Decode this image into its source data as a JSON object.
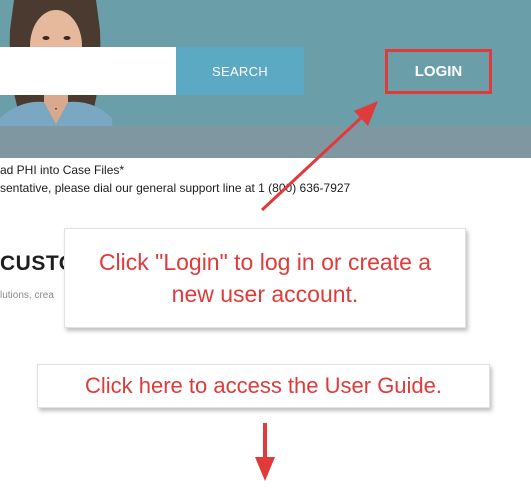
{
  "header": {
    "search": {
      "value": "",
      "placeholder": ""
    },
    "search_button_label": "SEARCH",
    "login_button_label": "LOGIN"
  },
  "notices": {
    "line1": "ad PHI into Case Files*",
    "line2": "sentative, please dial our general support line at 1 (800) 636-7927"
  },
  "main": {
    "heading": "CUSTO",
    "subtext": "lutions, crea"
  },
  "callouts": {
    "login_text": "Click \"Login\" to log in or create a new user account.",
    "guide_text": "Click here to access the User Guide."
  },
  "colors": {
    "hero_bg": "#6a9ea9",
    "search_button_bg": "#5ba9c3",
    "annotation_red": "#e03a3a"
  }
}
